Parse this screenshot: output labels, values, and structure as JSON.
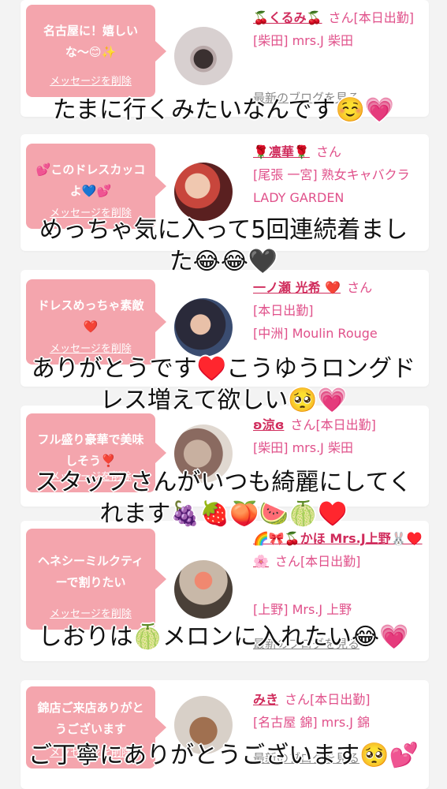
{
  "delete_label": "メッセージを削除",
  "blog_label": "最新のブログを見る",
  "san": "さん",
  "colors": {
    "bubble": "#f4a5ad",
    "name": "#d02c5c",
    "info": "#e0508a"
  },
  "cards": [
    {
      "message": "名古屋に！嬉しいな〜😊✨",
      "name": "🍒くるみ🍒",
      "status": "[本日出勤]",
      "shop": "[柴田] mrs.J 柴田"
    },
    {
      "message": "💕このドレスカッコよ💙💕",
      "name": "🌹凛華🌹",
      "status": "",
      "shop": "[尾張 一宮] 熟女キャバクラ LADY GARDEN"
    },
    {
      "message": "ドレスめっちゃ素敵❤️",
      "name": "一ノ瀬 光希 ❤️",
      "status": "[本日出勤]",
      "shop": "[中洲] Moulin Rouge"
    },
    {
      "message": "フル盛り豪華で美味しそう❣️",
      "name": "ʚ涼ɞ",
      "status": "[本日出勤]",
      "shop": "[柴田] mrs.J 柴田"
    },
    {
      "message": "ヘネシーミルクティーで割りたい",
      "name": "🌈🎀🍒かほ Mrs.J上野🐰♥️🌸",
      "status": "[本日出勤]",
      "shop": "[上野] Mrs.J 上野"
    },
    {
      "message": "錦店ご来店ありがとうございます",
      "name": "みき",
      "status": "[本日出勤]",
      "shop": "[名古屋 錦] mrs.J 錦"
    }
  ],
  "captions": [
    {
      "lines": [
        "たまに行くみたいなんです☺️💗"
      ]
    },
    {
      "lines": [
        "めっちゃ気に入って5回連続着まし",
        "た😂😂🖤"
      ]
    },
    {
      "lines": [
        "ありがとうです♥️こうゆうロングド",
        "レス増えて欲しい🥺💗"
      ]
    },
    {
      "lines": [
        "スタッフさんがいつも綺麗にしてく",
        "れます🍇🍓🍑🍉🍈♥️"
      ]
    },
    {
      "lines": [
        "しおりは🍈メロンに入れたい😂💗"
      ]
    },
    {
      "lines": [
        "ご丁寧にありがとうございます🥺💕"
      ]
    }
  ]
}
